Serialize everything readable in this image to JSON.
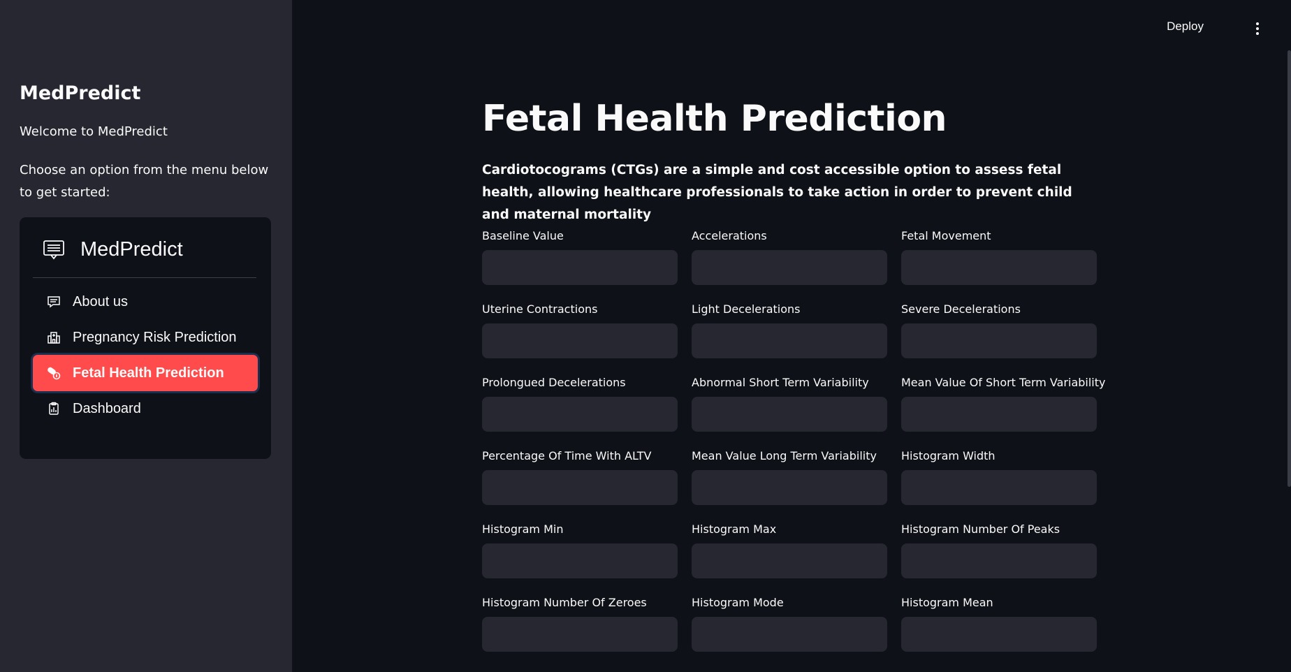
{
  "sidebar": {
    "title": "MedPredict",
    "welcome": "Welcome to MedPredict",
    "choose": "Choose an option from the menu below to get started:",
    "menu": {
      "header_title": "MedPredict",
      "header_icon": "chat-list-icon",
      "items": [
        {
          "label": "About us",
          "icon": "chat-icon",
          "active": false
        },
        {
          "label": "Pregnancy Risk Prediction",
          "icon": "hospital-icon",
          "active": false
        },
        {
          "label": "Fetal Health Prediction",
          "icon": "capsule-icon",
          "active": true
        },
        {
          "label": "Dashboard",
          "icon": "clipboard-data-icon",
          "active": false
        }
      ]
    }
  },
  "header": {
    "deploy_label": "Deploy",
    "menu_icon": "kebab-icon"
  },
  "main": {
    "title": "Fetal Health Prediction",
    "description": "Cardiotocograms (CTGs) are a simple and cost accessible option to assess fetal health, allowing healthcare professionals to take action in order to prevent child and maternal mortality",
    "fields": [
      {
        "label": "Baseline Value",
        "value": ""
      },
      {
        "label": "Accelerations",
        "value": ""
      },
      {
        "label": "Fetal Movement",
        "value": ""
      },
      {
        "label": "Uterine Contractions",
        "value": ""
      },
      {
        "label": "Light Decelerations",
        "value": ""
      },
      {
        "label": "Severe Decelerations",
        "value": ""
      },
      {
        "label": "Prolongued Decelerations",
        "value": ""
      },
      {
        "label": "Abnormal Short Term Variability",
        "value": ""
      },
      {
        "label": "Mean Value Of Short Term Variability",
        "value": ""
      },
      {
        "label": "Percentage Of Time With ALTV",
        "value": ""
      },
      {
        "label": "Mean Value Long Term Variability",
        "value": ""
      },
      {
        "label": "Histogram Width",
        "value": ""
      },
      {
        "label": "Histogram Min",
        "value": ""
      },
      {
        "label": "Histogram Max",
        "value": ""
      },
      {
        "label": "Histogram Number Of Peaks",
        "value": ""
      },
      {
        "label": "Histogram Number Of Zeroes",
        "value": ""
      },
      {
        "label": "Histogram Mode",
        "value": ""
      },
      {
        "label": "Histogram Mean",
        "value": ""
      }
    ]
  },
  "colors": {
    "background": "#0e1117",
    "sidebar": "#262730",
    "accent": "#ff4b4b",
    "input": "#262730"
  }
}
